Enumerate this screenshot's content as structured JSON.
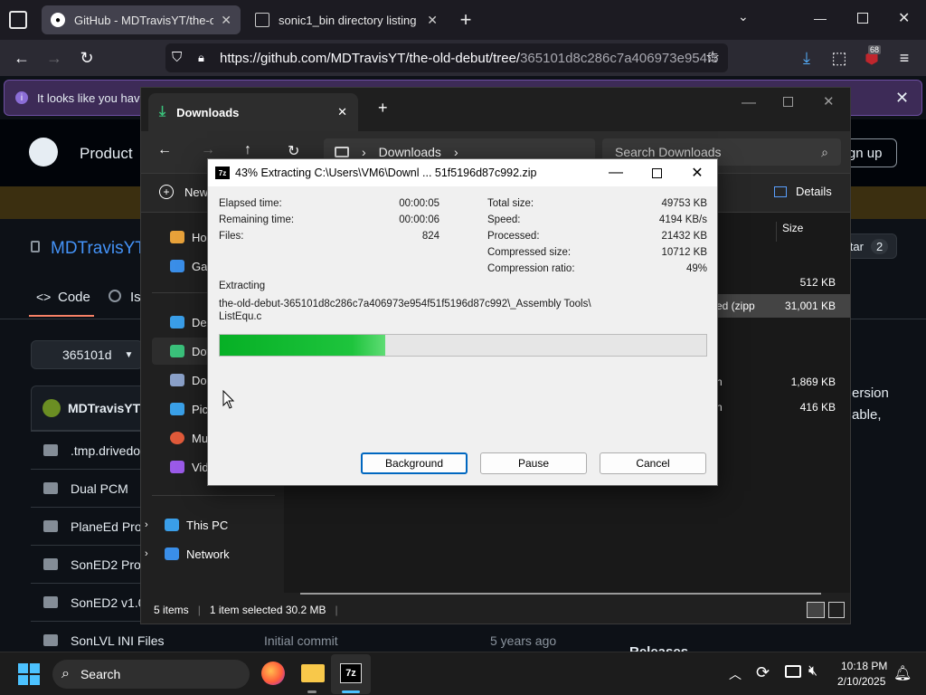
{
  "browser": {
    "tabs": [
      {
        "title": "GitHub - MDTravisYT/the-old-de",
        "active": true
      },
      {
        "title": "sonic1_bin directory listing",
        "active": false
      }
    ],
    "new_tab": "+",
    "url_main": "https://github.com/MDTravisYT/the-old-debut/tree/",
    "url_rest": "365101d8c286c7a406973e954f5",
    "downloads_badge": "68"
  },
  "github": {
    "notice": "It looks like you haven",
    "product": "Product",
    "sign_up": "ign up",
    "repo_name": "MDTravisYT",
    "tab_code": "Code",
    "tab_issues": "Is",
    "branch": "365101d",
    "owner": "MDTravisYT",
    "star_label": "tar",
    "star_count": "2",
    "rows": [
      {
        "name": ".tmp.drivedow",
        "commit": "",
        "age": ""
      },
      {
        "name": "Dual PCM",
        "commit": "",
        "age": ""
      },
      {
        "name": "PlaneEd Proje",
        "commit": "",
        "age": ""
      },
      {
        "name": "SonED2 Proje",
        "commit": "",
        "age": ""
      },
      {
        "name": "SonED2 v1.0",
        "commit": "",
        "age": ""
      },
      {
        "name": "SonLVL INI Files",
        "commit": "Initial commit",
        "age": "5 years ago"
      }
    ],
    "side_text_1": "ersion",
    "side_text_2": "able,",
    "releases": "Releases"
  },
  "explorer": {
    "tab_title": "Downloads",
    "address": "Downloads",
    "search_placeholder": "Search Downloads",
    "new_label": "New",
    "details_label": "Details",
    "size_header": "Size",
    "nav": [
      {
        "label": "Hor",
        "color": "#e8a23a"
      },
      {
        "label": "Gall",
        "color": "#3a8ee8"
      },
      {
        "label": "Des",
        "color": "#3a9ee8"
      },
      {
        "label": "Dov",
        "color": "#3ac07a"
      },
      {
        "label": "Doc",
        "color": "#8aa0c8"
      },
      {
        "label": "Pict",
        "color": "#3aa0e8"
      },
      {
        "label": "Mu",
        "color": "#e05a3a"
      },
      {
        "label": "Vid",
        "color": "#9a5ae8"
      }
    ],
    "this_pc": "This PC",
    "network": "Network",
    "files": [
      {
        "type": "",
        "size": "512 KB"
      },
      {
        "type": "ed (zipp",
        "size": "31,001 KB"
      },
      {
        "type": "n",
        "size": "1,869 KB"
      },
      {
        "type": "n",
        "size": "416 KB"
      }
    ],
    "status_items": "5 items",
    "status_selected": "1 item selected  30.2 MB"
  },
  "dialog": {
    "title": "43% Extracting C:\\Users\\VM6\\Downl ... 51f5196d87c992.zip",
    "left": [
      {
        "label": "Elapsed time:",
        "value": "00:00:05"
      },
      {
        "label": "Remaining time:",
        "value": "00:00:06"
      },
      {
        "label": "Files:",
        "value": "824"
      }
    ],
    "right": [
      {
        "label": "Total size:",
        "value": "49753 KB"
      },
      {
        "label": "Speed:",
        "value": "4194 KB/s"
      },
      {
        "label": "Processed:",
        "value": "21432 KB"
      },
      {
        "label": "Compressed size:",
        "value": "10712 KB"
      },
      {
        "label": "Compression ratio:",
        "value": "49%"
      }
    ],
    "extracting_label": "Extracting",
    "path_line1": "the-old-debut-365101d8c286c7a406973e954f51f5196d87c992\\_Assembly Tools\\",
    "path_line2": "ListEqu.c",
    "progress": 0.34,
    "buttons": {
      "background": "Background",
      "pause": "Pause",
      "cancel": "Cancel"
    }
  },
  "taskbar": {
    "search": "Search",
    "time": "10:18 PM",
    "date": "2/10/2025"
  }
}
